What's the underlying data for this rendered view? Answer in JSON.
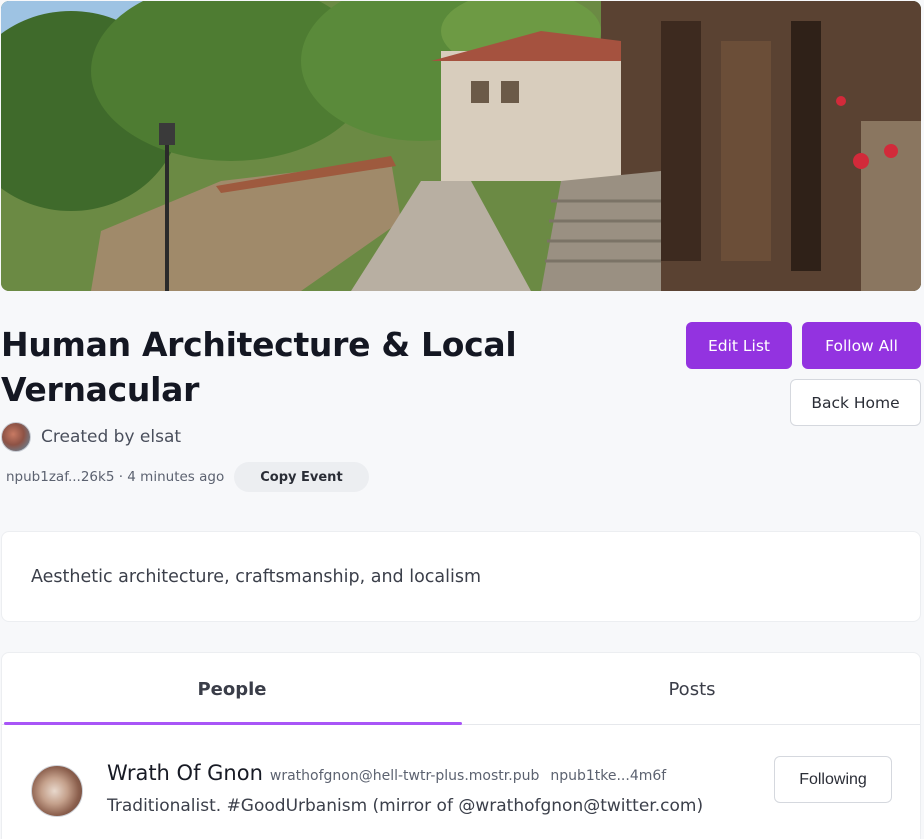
{
  "list": {
    "title": "Human Architecture & Local Vernacular",
    "created_by": "Created by elsat",
    "meta": "npub1zaf...26k5 · 4 minutes ago",
    "copy_event_label": "Copy Event",
    "description": "Aesthetic architecture, craftsmanship, and localism"
  },
  "actions": {
    "edit_label": "Edit List",
    "follow_all_label": "Follow All",
    "back_home_label": "Back Home"
  },
  "tabs": [
    {
      "label": "People",
      "active": true
    },
    {
      "label": "Posts",
      "active": false
    }
  ],
  "people": [
    {
      "name": "Wrath Of Gnon",
      "nip05": "wrathofgnon@hell-twtr-plus.mostr.pub",
      "npub": "npub1tke...4m6f",
      "bio": "Traditionalist. #GoodUrbanism (mirror of @wrathofgnon@twitter.com)",
      "follow_state": "Following"
    }
  ],
  "colors": {
    "accent": "#9333e0",
    "tab_indicator": "#a855f7",
    "background": "#f7f8fa"
  }
}
